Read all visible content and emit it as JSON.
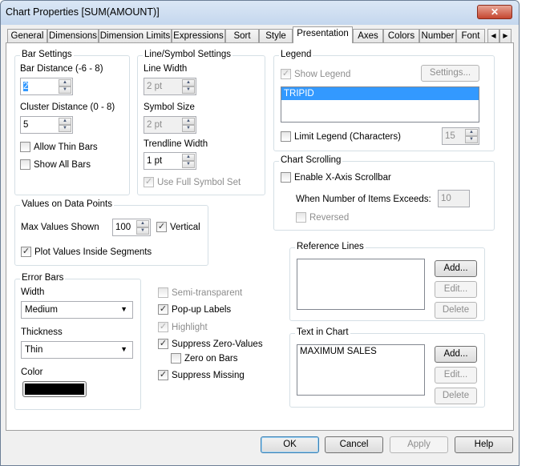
{
  "window": {
    "title": "Chart Properties [SUM(AMOUNT)]",
    "close_icon": "close-icon"
  },
  "tabs": [
    "General",
    "Dimensions",
    "Dimension Limits",
    "Expressions",
    "Sort",
    "Style",
    "Presentation",
    "Axes",
    "Colors",
    "Number",
    "Font"
  ],
  "active_tab": "Presentation",
  "bar_settings": {
    "title": "Bar Settings",
    "bar_distance_label": "Bar Distance (-6 - 8)",
    "bar_distance": "2",
    "cluster_distance_label": "Cluster Distance (0 - 8)",
    "cluster_distance": "5",
    "allow_thin_bars": "Allow Thin Bars",
    "show_all_bars": "Show All Bars"
  },
  "line_symbol": {
    "title": "Line/Symbol Settings",
    "line_width_label": "Line Width",
    "line_width": "2 pt",
    "symbol_size_label": "Symbol Size",
    "symbol_size": "2 pt",
    "trendline_width_label": "Trendline Width",
    "trendline_width": "1 pt",
    "use_full_symbol_set": "Use Full Symbol Set"
  },
  "values_on_data_points": {
    "title": "Values on Data Points",
    "max_values_label": "Max Values Shown",
    "max_values": "100",
    "vertical": "Vertical",
    "plot_inside": "Plot Values Inside Segments"
  },
  "error_bars": {
    "title": "Error Bars",
    "width_label": "Width",
    "width": "Medium",
    "thickness_label": "Thickness",
    "thickness": "Thin",
    "color_label": "Color",
    "color": "#000000"
  },
  "misc": {
    "semi_transparent": "Semi-transparent",
    "popup_labels": "Pop-up Labels",
    "highlight": "Highlight",
    "suppress_zero": "Suppress Zero-Values",
    "zero_on_bars": "Zero on Bars",
    "suppress_missing": "Suppress Missing"
  },
  "legend": {
    "title": "Legend",
    "show_legend": "Show Legend",
    "settings": "Settings...",
    "items": [
      "TRIPID"
    ],
    "limit_legend": "Limit Legend (Characters)",
    "limit_value": "15"
  },
  "chart_scrolling": {
    "title": "Chart Scrolling",
    "enable_scrollbar": "Enable X-Axis Scrollbar",
    "when_exceeds_label": "When Number of Items Exceeds:",
    "when_exceeds": "10",
    "reversed": "Reversed"
  },
  "reference_lines": {
    "title": "Reference Lines",
    "add": "Add...",
    "edit": "Edit...",
    "delete": "Delete"
  },
  "text_in_chart": {
    "title": "Text in Chart",
    "items": [
      "MAXIMUM SALES"
    ],
    "add": "Add...",
    "edit": "Edit...",
    "delete": "Delete"
  },
  "footer": {
    "ok": "OK",
    "cancel": "Cancel",
    "apply": "Apply",
    "help": "Help"
  }
}
